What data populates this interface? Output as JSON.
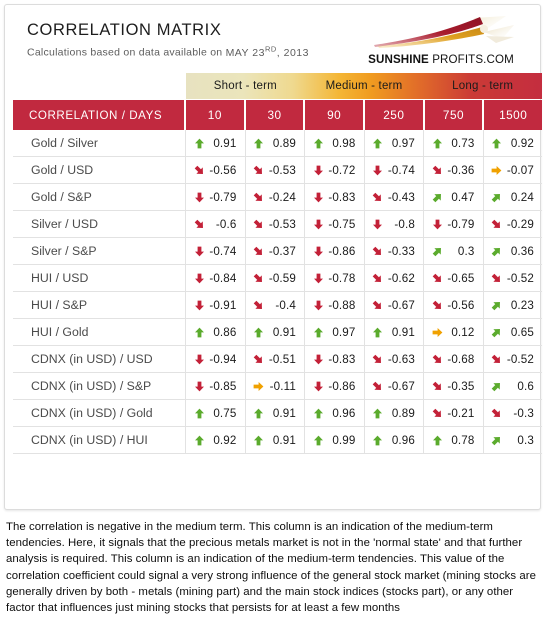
{
  "header": {
    "title": "CORRELATION MATRIX",
    "subtitle_prefix": "Calculations based on data available on",
    "date_month_day": "MAY 23",
    "date_ordinal": "RD",
    "date_comma_year": ", 2013",
    "logo_bold": "SUNSHINE",
    "logo_regular": " PROFITS.COM"
  },
  "colors": {
    "red": "#c1293f",
    "gradient_start": "#e7e2c0",
    "gradient_mid": "#f0a829",
    "gradient_end": "#c42d3f",
    "positive": "#5bab2d",
    "negative": "#c32138",
    "neutral": "#f0a100"
  },
  "terms": [
    {
      "label": "Short - term"
    },
    {
      "label": "Medium - term"
    },
    {
      "label": "Long - term"
    }
  ],
  "table": {
    "corner_label": "CORRELATION / DAYS",
    "day_columns": [
      "10",
      "30",
      "90",
      "250",
      "750",
      "1500"
    ],
    "rows": [
      {
        "label": "Gold / Silver",
        "cells": [
          {
            "value": "0.91",
            "dir": "up"
          },
          {
            "value": "0.89",
            "dir": "up"
          },
          {
            "value": "0.98",
            "dir": "up"
          },
          {
            "value": "0.97",
            "dir": "up"
          },
          {
            "value": "0.73",
            "dir": "up"
          },
          {
            "value": "0.92",
            "dir": "up"
          }
        ]
      },
      {
        "label": "Gold / USD",
        "cells": [
          {
            "value": "-0.56",
            "dir": "down-right"
          },
          {
            "value": "-0.53",
            "dir": "down-right"
          },
          {
            "value": "-0.72",
            "dir": "down"
          },
          {
            "value": "-0.74",
            "dir": "down"
          },
          {
            "value": "-0.36",
            "dir": "down-right"
          },
          {
            "value": "-0.07",
            "dir": "flat"
          }
        ]
      },
      {
        "label": "Gold / S&P",
        "cells": [
          {
            "value": "-0.79",
            "dir": "down"
          },
          {
            "value": "-0.24",
            "dir": "down-right"
          },
          {
            "value": "-0.83",
            "dir": "down"
          },
          {
            "value": "-0.43",
            "dir": "down-right"
          },
          {
            "value": "0.47",
            "dir": "up-right"
          },
          {
            "value": "0.24",
            "dir": "up-right"
          }
        ]
      },
      {
        "label": "Silver / USD",
        "cells": [
          {
            "value": "-0.6",
            "dir": "down-right"
          },
          {
            "value": "-0.53",
            "dir": "down-right"
          },
          {
            "value": "-0.75",
            "dir": "down"
          },
          {
            "value": "-0.8",
            "dir": "down"
          },
          {
            "value": "-0.79",
            "dir": "down"
          },
          {
            "value": "-0.29",
            "dir": "down-right"
          }
        ]
      },
      {
        "label": "Silver / S&P",
        "cells": [
          {
            "value": "-0.74",
            "dir": "down"
          },
          {
            "value": "-0.37",
            "dir": "down-right"
          },
          {
            "value": "-0.86",
            "dir": "down"
          },
          {
            "value": "-0.33",
            "dir": "down-right"
          },
          {
            "value": "0.3",
            "dir": "up-right"
          },
          {
            "value": "0.36",
            "dir": "up-right"
          }
        ]
      },
      {
        "label": "HUI / USD",
        "cells": [
          {
            "value": "-0.84",
            "dir": "down"
          },
          {
            "value": "-0.59",
            "dir": "down-right"
          },
          {
            "value": "-0.78",
            "dir": "down"
          },
          {
            "value": "-0.62",
            "dir": "down-right"
          },
          {
            "value": "-0.65",
            "dir": "down-right"
          },
          {
            "value": "-0.52",
            "dir": "down-right"
          }
        ]
      },
      {
        "label": "HUI / S&P",
        "cells": [
          {
            "value": "-0.91",
            "dir": "down"
          },
          {
            "value": "-0.4",
            "dir": "down-right"
          },
          {
            "value": "-0.88",
            "dir": "down"
          },
          {
            "value": "-0.67",
            "dir": "down-right"
          },
          {
            "value": "-0.56",
            "dir": "down-right"
          },
          {
            "value": "0.23",
            "dir": "up-right"
          }
        ]
      },
      {
        "label": "HUI / Gold",
        "cells": [
          {
            "value": "0.86",
            "dir": "up"
          },
          {
            "value": "0.91",
            "dir": "up"
          },
          {
            "value": "0.97",
            "dir": "up"
          },
          {
            "value": "0.91",
            "dir": "up"
          },
          {
            "value": "0.12",
            "dir": "flat"
          },
          {
            "value": "0.65",
            "dir": "up-right"
          }
        ]
      },
      {
        "label": "CDNX (in USD) / USD",
        "cells": [
          {
            "value": "-0.94",
            "dir": "down"
          },
          {
            "value": "-0.51",
            "dir": "down-right"
          },
          {
            "value": "-0.83",
            "dir": "down"
          },
          {
            "value": "-0.63",
            "dir": "down-right"
          },
          {
            "value": "-0.68",
            "dir": "down-right"
          },
          {
            "value": "-0.52",
            "dir": "down-right"
          }
        ]
      },
      {
        "label": "CDNX (in USD) / S&P",
        "cells": [
          {
            "value": "-0.85",
            "dir": "down"
          },
          {
            "value": "-0.11",
            "dir": "flat"
          },
          {
            "value": "-0.86",
            "dir": "down"
          },
          {
            "value": "-0.67",
            "dir": "down-right"
          },
          {
            "value": "-0.35",
            "dir": "down-right"
          },
          {
            "value": "0.6",
            "dir": "up-right"
          }
        ]
      },
      {
        "label": "CDNX (in USD) / Gold",
        "cells": [
          {
            "value": "0.75",
            "dir": "up"
          },
          {
            "value": "0.91",
            "dir": "up"
          },
          {
            "value": "0.96",
            "dir": "up"
          },
          {
            "value": "0.89",
            "dir": "up"
          },
          {
            "value": "-0.21",
            "dir": "down-right"
          },
          {
            "value": "-0.3",
            "dir": "down-right"
          }
        ]
      },
      {
        "label": "CDNX (in USD) / HUI",
        "cells": [
          {
            "value": "0.92",
            "dir": "up"
          },
          {
            "value": "0.91",
            "dir": "up"
          },
          {
            "value": "0.99",
            "dir": "up"
          },
          {
            "value": "0.96",
            "dir": "up"
          },
          {
            "value": "0.78",
            "dir": "up"
          },
          {
            "value": "0.3",
            "dir": "up-right"
          }
        ]
      }
    ]
  },
  "note": {
    "text": "The correlation is negative in the medium term. This column is an indication of the medium-term tendencies. Here, it signals that the precious metals market is not in the 'normal state' and that further analysis is required. This column is an indication of the medium-term tendencies. This value of the correlation coefficient could signal a very strong influence of the general stock market (mining stocks are generally driven by both - metals (mining part) and the main stock indices (stocks part), or any other factor that influences just mining stocks that persists for at least a few months"
  }
}
